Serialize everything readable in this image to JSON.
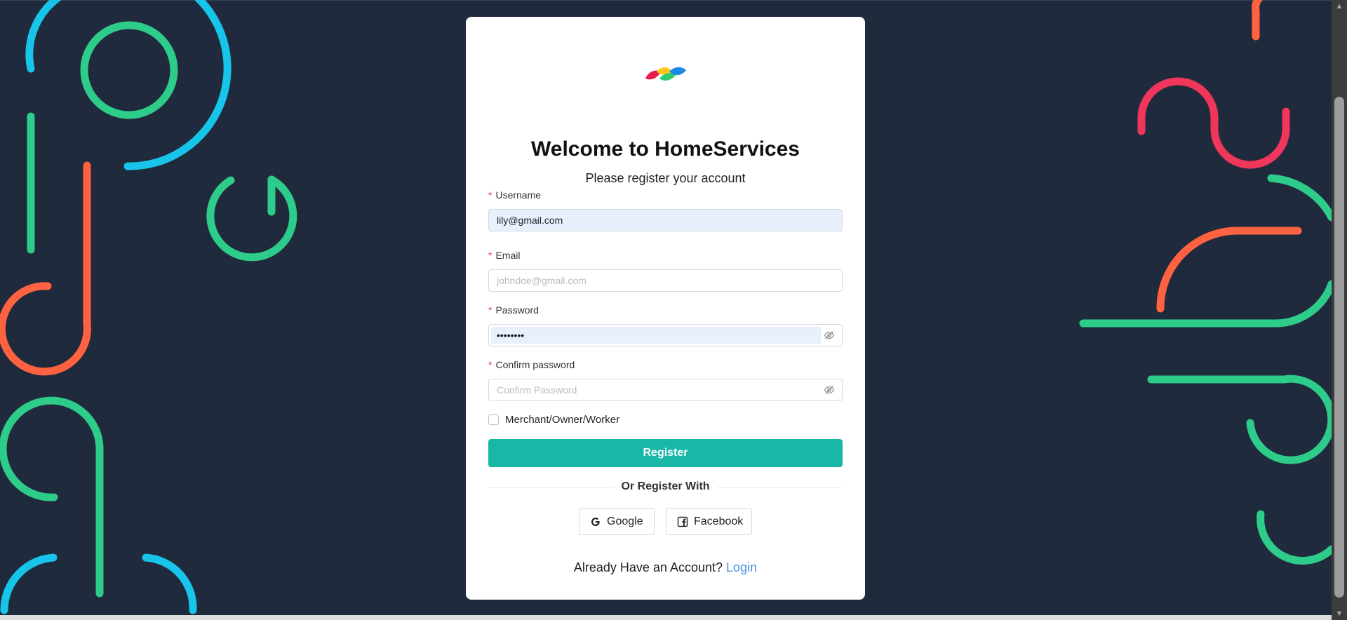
{
  "page": {
    "background_color": "#1f2a3c",
    "accent_colors": [
      "#17b8a6",
      "#2ecc8a",
      "#18c5ea",
      "#ff6240",
      "#f0365a"
    ]
  },
  "logo": {
    "icon": "brand-logo-icon"
  },
  "header": {
    "title": "Welcome to HomeServices",
    "subtitle": "Please register your account"
  },
  "form": {
    "required_mark": "*",
    "username": {
      "label": "Username",
      "value": "lily@gmail.com"
    },
    "email": {
      "label": "Email",
      "placeholder": "johndoe@gmail.com",
      "value": ""
    },
    "password": {
      "label": "Password",
      "value": "••••••••",
      "toggle_icon": "eye-off-icon"
    },
    "confirm_password": {
      "label": "Confirm password",
      "placeholder": "Confirm Password",
      "value": "",
      "toggle_icon": "eye-off-icon"
    },
    "merchant_checkbox": {
      "label": "Merchant/Owner/Worker",
      "checked": false
    },
    "register_button": "Register"
  },
  "social": {
    "divider_text": "Or Register With",
    "google_label": "Google",
    "facebook_label": "Facebook"
  },
  "footer": {
    "prompt": "Already Have an Account?",
    "login_link": "Login"
  }
}
